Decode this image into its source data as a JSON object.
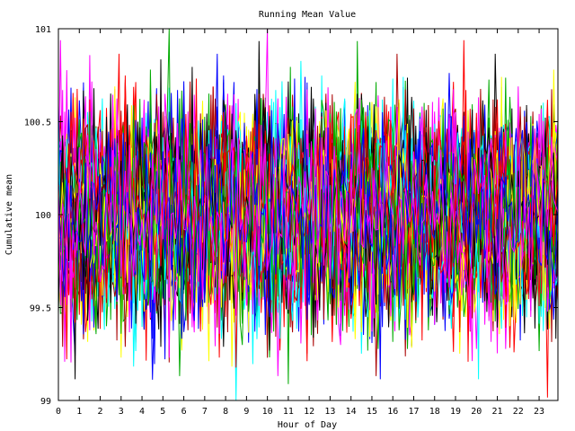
{
  "chart_data": {
    "type": "line",
    "title": "Running Mean Value",
    "xlabel": "Hour of Day",
    "ylabel": "Cumulative mean",
    "xlim": [
      0,
      23.9
    ],
    "ylim": [
      99,
      101
    ],
    "x_ticks": [
      "0",
      "1",
      "2",
      "3",
      "4",
      "5",
      "6",
      "7",
      "8",
      "9",
      "10",
      "11",
      "12",
      "13",
      "14",
      "15",
      "16",
      "17",
      "18",
      "19",
      "20",
      "21",
      "22",
      "23"
    ],
    "y_ticks": [
      "99",
      "99.5",
      "100",
      "100.5",
      "101"
    ],
    "grid": false,
    "legend": "none",
    "series_count": 60,
    "samples_per_hour": 10,
    "series_center": 100,
    "series_typical_range": [
      99.5,
      100.6
    ],
    "series_extremes": {
      "min": 99,
      "max": 100.94
    },
    "colors": [
      "#ff0000",
      "#00aa00",
      "#0000ff",
      "#ff00ff",
      "#00ffff",
      "#aa0000",
      "#ffff00",
      "#000000"
    ]
  }
}
